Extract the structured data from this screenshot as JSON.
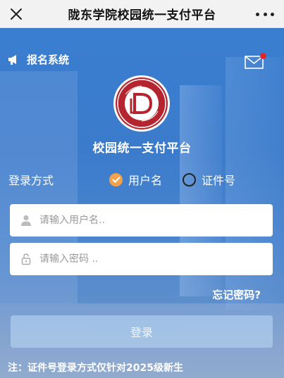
{
  "navbar": {
    "title": "陇东学院校园统一支付平台"
  },
  "header": {
    "register_label": "报名系统"
  },
  "app": {
    "title": "校园统一支付平台"
  },
  "login_mode": {
    "label": "登录方式",
    "options": [
      {
        "label": "用户名",
        "selected": true
      },
      {
        "label": "证件号",
        "selected": false
      }
    ]
  },
  "form": {
    "username_placeholder": "请输入用户名..",
    "password_placeholder": "请输入密码 ..",
    "forgot_label": "忘记密码?",
    "login_label": "登录"
  },
  "note": "注：证件号登录方式仅针对2025级新生",
  "colors": {
    "accent": "#f5a14a",
    "background": "#3b7bcb",
    "notification": "#e0262b",
    "logo": "#b5252f"
  }
}
